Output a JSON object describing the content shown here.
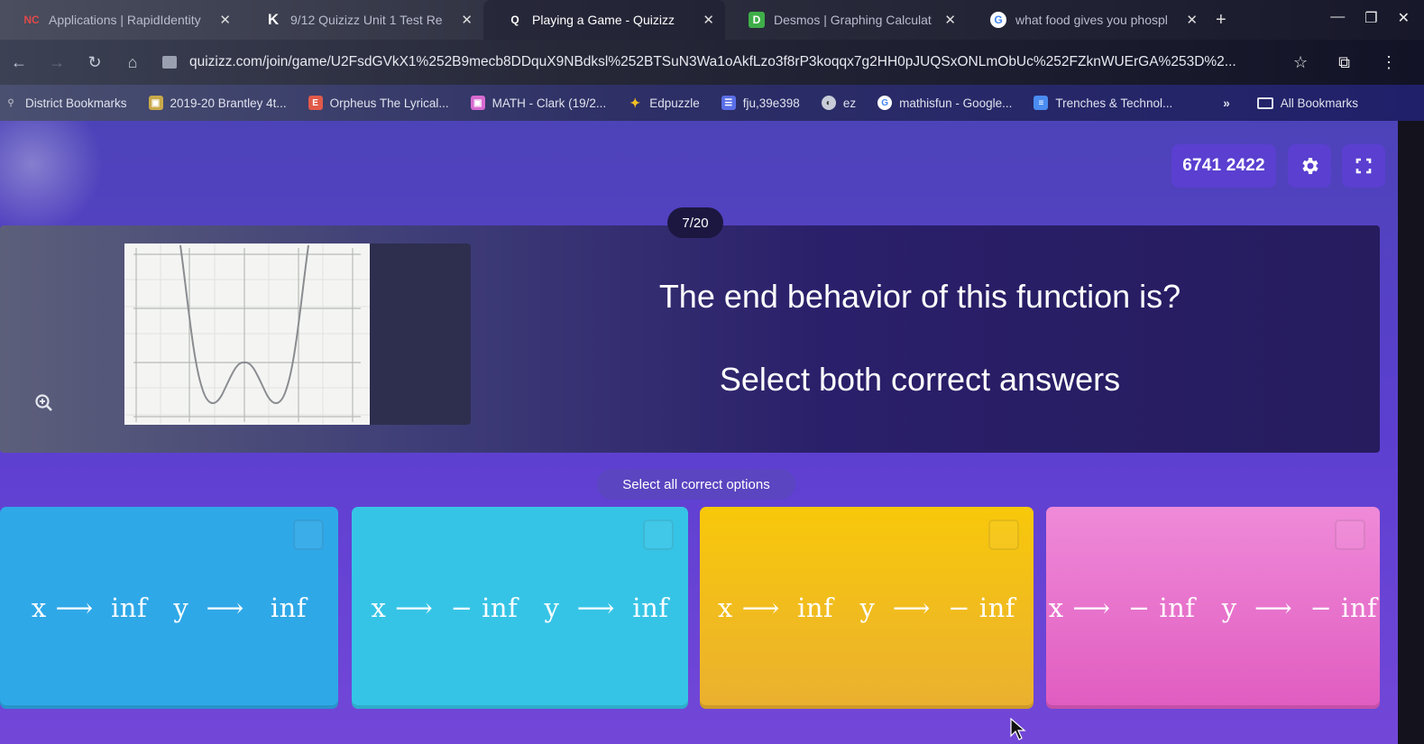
{
  "browser": {
    "tabs": [
      {
        "favicon": "NC",
        "favicon_color": "#e04a4a",
        "title": "Applications | RapidIdentity",
        "active": false
      },
      {
        "favicon": "K",
        "favicon_color": "#ffffff",
        "title": "9/12 Quizizz Unit 1 Test Re",
        "active": false
      },
      {
        "favicon": "Q",
        "favicon_color": "#ffffff",
        "title": "Playing a Game - Quizizz",
        "active": true
      },
      {
        "favicon": "D",
        "favicon_color": "#3fae49",
        "title": "Desmos | Graphing Calculat",
        "active": false
      },
      {
        "favicon": "G",
        "favicon_color": "#ffffff",
        "title": "what food gives you phospl",
        "active": false
      }
    ],
    "new_tab_label": "+",
    "url": "quizizz.com/join/game/U2FsdGVkX1%252B9mecb8DDquX9NBdksl%252BTSuN3Wa1oAkfLzo3f8rP3koqqx7g2HH0pJUQSxONLmObUc%252FZknWUErGA%253D%2...",
    "bookmarks": [
      {
        "icon": "district-icon",
        "label": "District Bookmarks",
        "color": "#8a90a8"
      },
      {
        "icon": "classroom-icon",
        "label": "2019-20 Brantley 4t...",
        "color": "#c9a94a"
      },
      {
        "icon": "e-icon",
        "label": "Orpheus The Lyrical...",
        "color": "#e05a4a"
      },
      {
        "icon": "classroom-icon",
        "label": "MATH - Clark (19/2...",
        "color": "#d86ad0"
      },
      {
        "icon": "edpuzzle-icon",
        "label": "Edpuzzle",
        "color": "#f2c023"
      },
      {
        "icon": "sheets-icon",
        "label": "fju,39e398",
        "color": "#5a6ee8"
      },
      {
        "icon": "globe-icon",
        "label": "ez",
        "color": "#c8ccd8"
      },
      {
        "icon": "google-icon",
        "label": "mathisfun - Google...",
        "color": "#ffffff"
      },
      {
        "icon": "docs-icon",
        "label": "Trenches & Technol...",
        "color": "#4a8cf0"
      }
    ],
    "more_label": "»",
    "all_bookmarks_label": "All Bookmarks"
  },
  "quiz": {
    "game_code": "6741 2422",
    "counter": "7/20",
    "question": "The end behavior of this function is?",
    "subtitle": "Select both correct answers",
    "instruction": "Select all correct options",
    "options": [
      {
        "text": "x ⟶  inf   y  ⟶   inf",
        "color": "#2fa8e8"
      },
      {
        "text": "x ⟶  − inf   y  ⟶  inf",
        "color": "#36c4e6"
      },
      {
        "text": "x ⟶  inf   y  ⟶  − inf",
        "color": "#f3b714"
      },
      {
        "text": "x ⟶  − inf   y  ⟶  − inf",
        "color": "#e66ac8"
      }
    ]
  }
}
